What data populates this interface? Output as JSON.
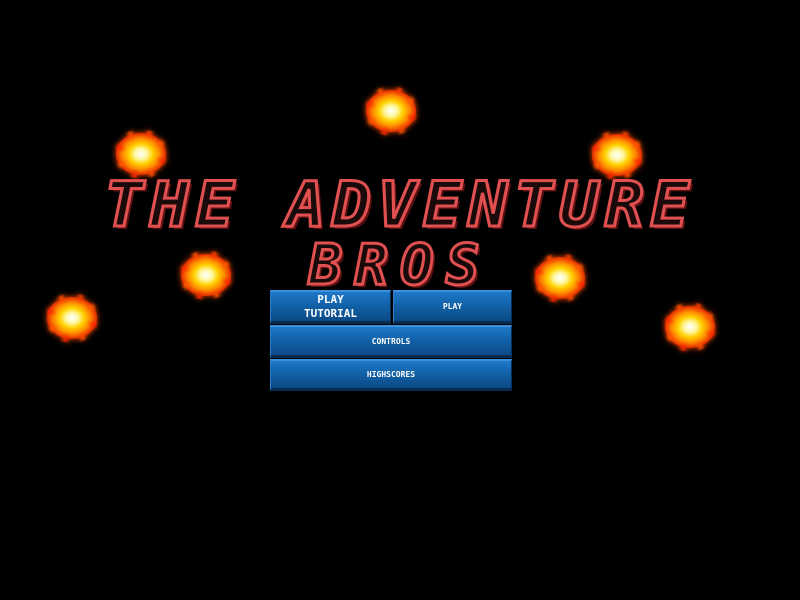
{
  "game": {
    "title_line_1": "THE ADVENTURE",
    "title_line_2": "BROS",
    "colors": {
      "background": "#000000",
      "title_outline": "#e05050",
      "button_blue": "#1262a8",
      "button_text": "#ffffff",
      "fireball_core": "#fff7a0",
      "fireball_outer": "#e52a00"
    }
  },
  "menu": {
    "play_tutorial_line_1": "PLAY",
    "play_tutorial_line_2": "TUTORIAL",
    "play_label": "PLAY",
    "controls_label": "CONTROLS",
    "highscores_label": "HIGHSCORES"
  }
}
